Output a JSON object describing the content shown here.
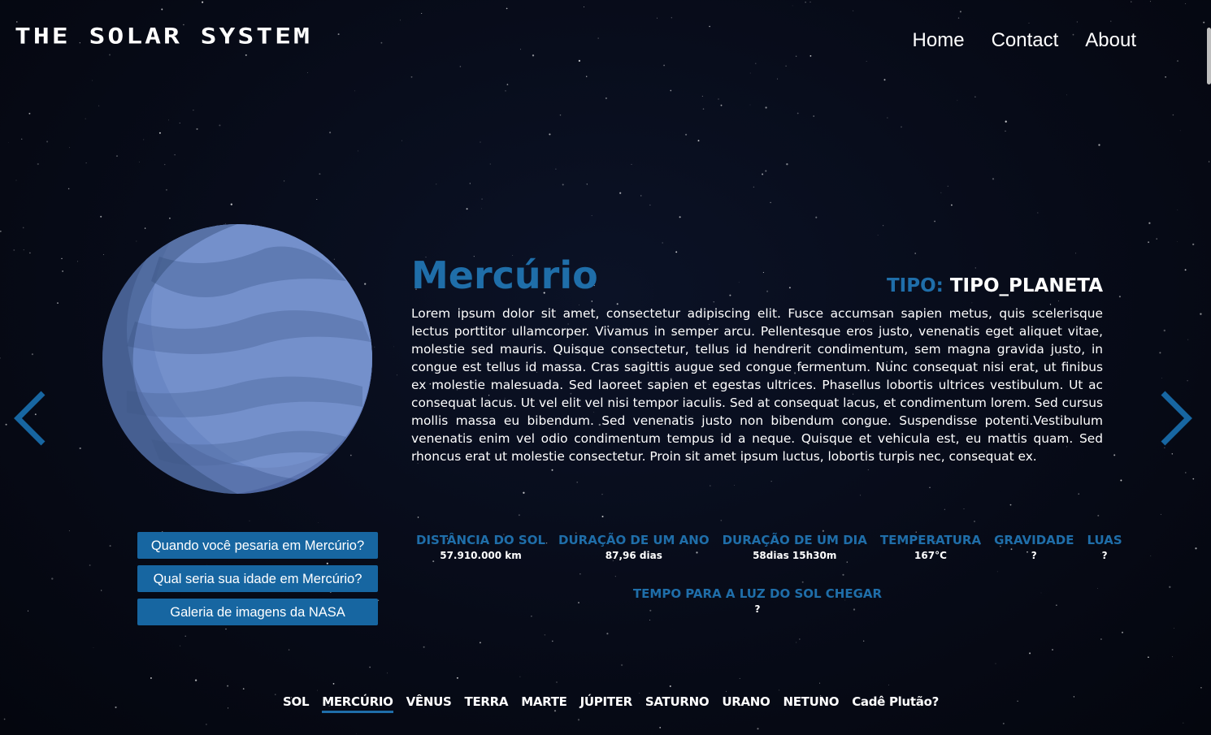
{
  "header": {
    "logo": "THE SOLAR SYSTEM",
    "nav": [
      "Home",
      "Contact",
      "About"
    ]
  },
  "planet": {
    "name": "Mercúrio",
    "tipo_label": "TIPO:",
    "tipo_value": "TIPO_PLANETA",
    "description": "Lorem ipsum dolor sit amet, consectetur adipiscing elit. Fusce accumsan sapien metus, quis scelerisque lectus porttitor ullamcorper. Vivamus in semper arcu. Pellentesque eros justo, venenatis eget aliquet vitae, molestie sed mauris. Quisque consectetur, tellus id hendrerit condimentum, sem magna gravida justo, in congue est tellus id massa. Cras sagittis augue sed congue fermentum. Nunc consequat nisi erat, ut finibus ex molestie malesuada. Sed laoreet sapien et egestas ultrices. Phasellus lobortis ultrices vestibulum. Ut ac consequat lacus. Ut vel elit vel nisi tempor iaculis. Sed at consequat lacus, et condimentum lorem. Sed cursus mollis massa eu bibendum. Sed venenatis justo non bibendum congue. Suspendisse potenti.Vestibulum venenatis enim vel odio condimentum tempus id a neque. Quisque et vehicula est, eu mattis quam. Sed rhoncus erat ut molestie consectetur. Proin sit amet ipsum luctus, lobortis turpis nec, consequat ex."
  },
  "actions": {
    "weight": "Quando você pesaria em Mercúrio?",
    "age": "Qual seria sua idade em Mercúrio?",
    "gallery": "Galeria de imagens da NASA"
  },
  "stats": [
    {
      "label": "DISTÂNCIA DO SOL",
      "value": "57.910.000 km"
    },
    {
      "label": "DURAÇÃO DE UM ANO",
      "value": "87,96 dias"
    },
    {
      "label": "DURAÇÃO DE UM DIA",
      "value": "58dias 15h30m"
    },
    {
      "label": "TEMPERATURA",
      "value": "167°C"
    },
    {
      "label": "GRAVIDADE",
      "value": "?"
    },
    {
      "label": "LUAS",
      "value": "?"
    }
  ],
  "light_time": {
    "label": "TEMPO PARA A LUZ DO SOL CHEGAR",
    "value": "?"
  },
  "planet_nav": [
    "SOL",
    "MERCÚRIO",
    "VÊNUS",
    "TERRA",
    "MARTE",
    "JÚPITER",
    "SATURNO",
    "URANO",
    "NETUNO",
    "Cadê Plutão?"
  ],
  "active_planet_index": 1,
  "icons": {
    "prev": "chevron-left-icon",
    "next": "chevron-right-icon"
  },
  "colors": {
    "accent": "#1f6ea9",
    "button": "#1766a1",
    "background": "#070b18",
    "planet": "#6b86c2"
  }
}
